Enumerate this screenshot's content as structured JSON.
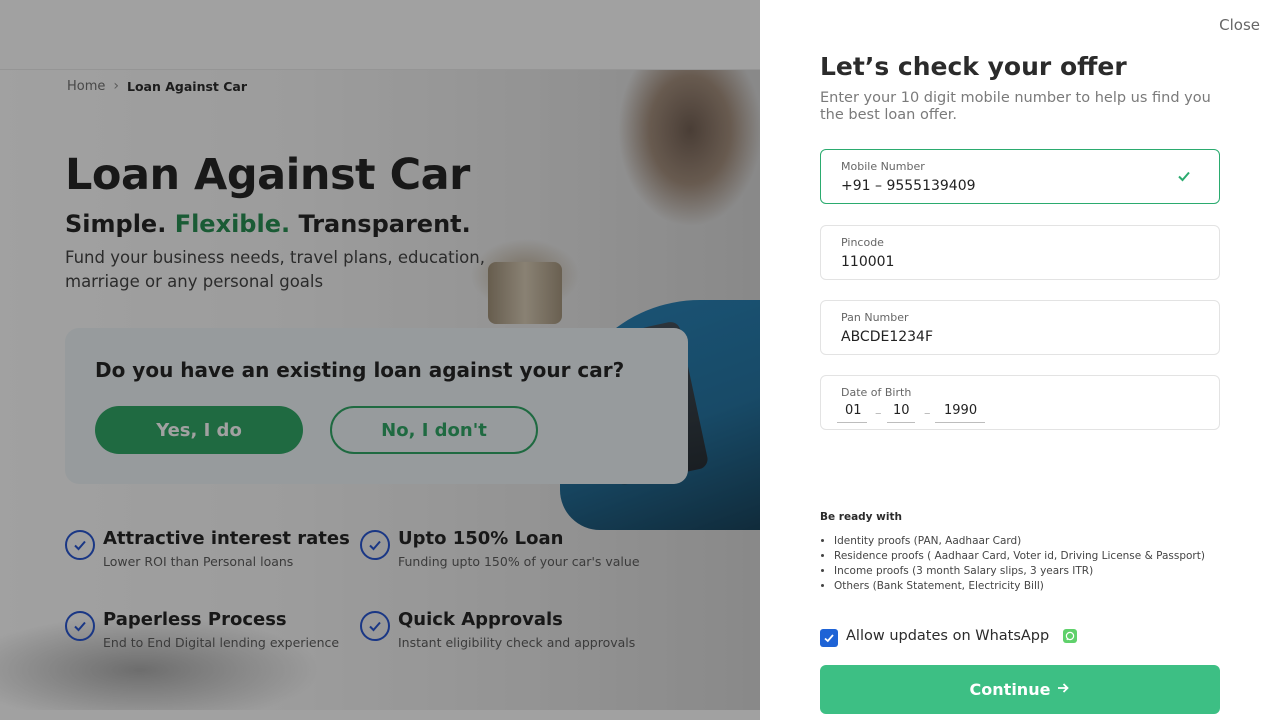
{
  "breadcrumb": {
    "home": "Home",
    "separator": "›",
    "current": "Loan Against Car"
  },
  "hero": {
    "title": "Loan Against Car",
    "tagline_1": "Simple.",
    "tagline_2": "Flexible.",
    "tagline_3": "Transparent.",
    "description": "Fund your business needs, travel plans, education, marriage or any personal goals"
  },
  "question": {
    "text": "Do you have an existing loan against your car?",
    "yes_label": "Yes, I do",
    "no_label": "No, I don't"
  },
  "features": [
    {
      "title": "Attractive interest rates",
      "subtitle": "Lower ROI than Personal loans"
    },
    {
      "title": "Upto 150% Loan",
      "subtitle": "Funding upto 150% of your car's value"
    },
    {
      "title": "Paperless Process",
      "subtitle": "End to End Digital lending experience"
    },
    {
      "title": "Quick Approvals",
      "subtitle": "Instant eligibility check and approvals"
    }
  ],
  "drawer": {
    "close_label": "Close",
    "title": "Let’s check your offer",
    "subtitle": "Enter your 10 digit mobile number to help us find you the best loan offer.",
    "mobile": {
      "label": "Mobile Number",
      "prefix": "+91 –",
      "value": "9555139409"
    },
    "pincode": {
      "label": "Pincode",
      "value": "110001"
    },
    "pan": {
      "label": "Pan Number",
      "value": "ABCDE1234F"
    },
    "dob": {
      "label": "Date of Birth",
      "day": "01",
      "month": "10",
      "year": "1990"
    },
    "ready": {
      "title": "Be ready with",
      "items": [
        "Identity proofs (PAN, Aadhaar Card)",
        "Residence proofs ( Aadhaar Card, Voter id, Driving License & Passport)",
        "Income proofs (3 month Salary slips, 3 years ITR)",
        "Others (Bank Statement, Electricity Bill)"
      ]
    },
    "whatsapp_label": "Allow updates on WhatsApp",
    "whatsapp_checked": true,
    "continue_label": "Continue"
  },
  "colors": {
    "brand_green": "#27a35f",
    "continue_green": "#3dbf84",
    "check_blue": "#1f4fd1",
    "checkbox_blue": "#1e63d6"
  }
}
